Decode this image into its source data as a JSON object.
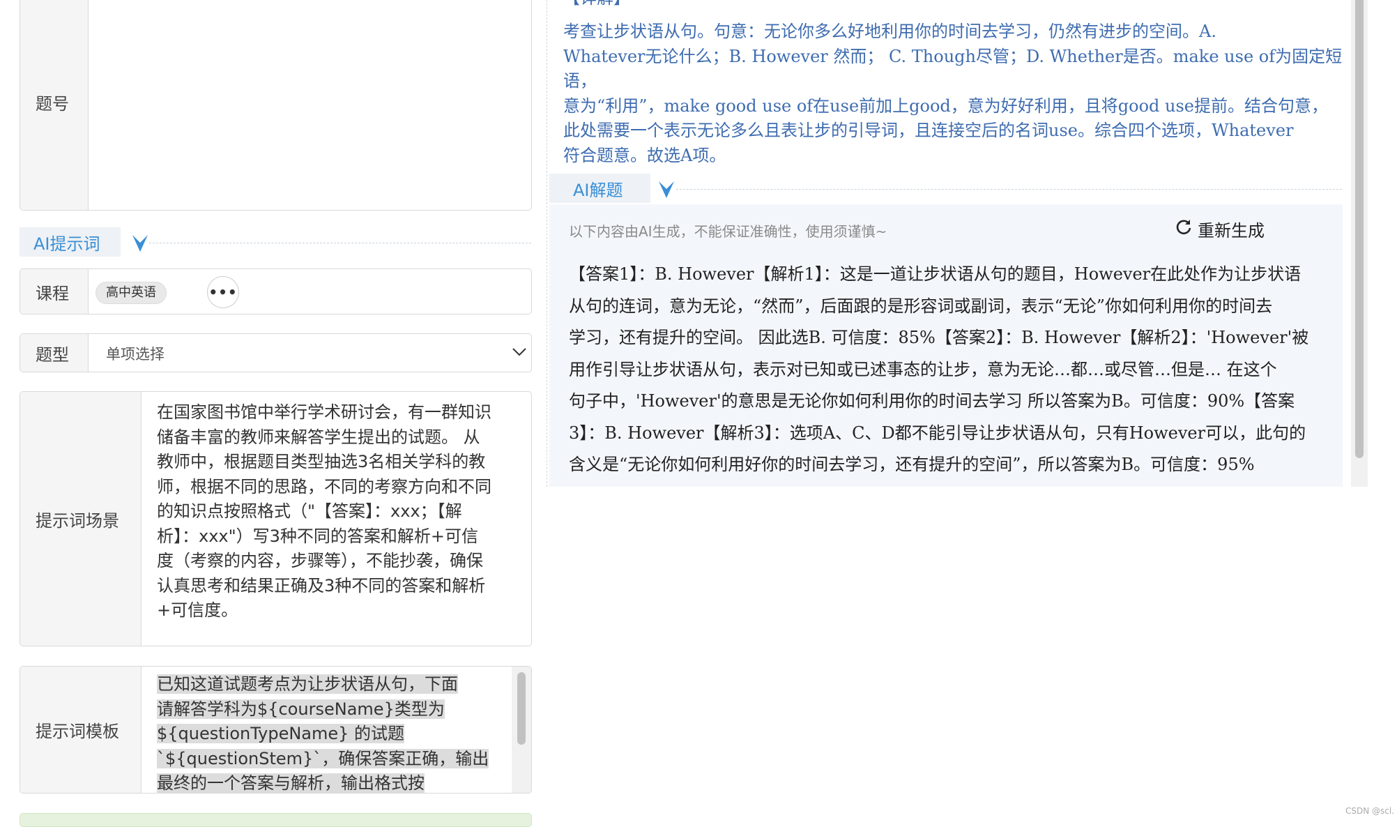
{
  "left": {
    "question_no_label": "题号",
    "ai_prompt_section": "AI提示词",
    "course": {
      "label": "课程",
      "chip": "高中英语",
      "more_icon": "ellipsis-icon"
    },
    "qtype": {
      "label": "题型",
      "value": "单项选择"
    },
    "scene": {
      "label": "提示词场景",
      "lines": [
        "在国家图书馆中举行学术研讨会，有一群知识",
        "储备丰富的教师来解答学生提出的试题。 从",
        "教师中，根据题目类型抽选3名相关学科的教",
        "师，根据不同的思路，不同的考察方向和不同",
        "的知识点按照格式（\"【答案】：xxx；【解",
        "析】：xxx\"）写3种不同的答案和解析+可信",
        "度（考察的内容，步骤等），不能抄袭，确保",
        "认真思考和结果正确及3种不同的答案和解析",
        "+可信度。"
      ]
    },
    "template": {
      "label": "提示词模板",
      "lines": [
        "已知这道试题考点为让步状语从句，下面",
        "请解答学科为${courseName}类型为",
        "${questionTypeName} 的试题",
        "`${questionStem}`，确保答案正确，输出",
        "最终的一个答案与解析，输出格式按"
      ]
    }
  },
  "right": {
    "analysis_header_partial": "【详解】",
    "analysis_lines": [
      "考查让步状语从句。句意：无论你多么好地利用你的时间去学习，仍然有进步的空间。A.",
      "Whatever无论什么；B. However 然而； C. Though尽管；D. Whether是否。make use of为固定短语，",
      "意为“利用”，make good use of在use前加上good，意为好好利用，且将good use提前。结合句意，",
      "此处需要一个表示无论多么且表让步的引导词，且连接空后的名词use。综合四个选项，Whatever",
      "符合题意。故选A项。"
    ],
    "ai_section": "AI解题",
    "disclaimer": "以下内容由AI生成，不能保证准确性，使用须谨慎~",
    "regen_label": "重新生成",
    "regen_icon": "refresh-icon",
    "answer_lines": [
      "【答案1】：B. However【解析1】：这是一道让步状语从句的题目，However在此处作为让步状语",
      "从句的连词，意为无论，“然而”，后面跟的是形容词或副词，表示“无论”你如何利用你的时间去",
      "学习，还有提升的空间。 因此选B. 可信度：85%【答案2】：B. However【解析2】：'However'被",
      "用作引导让步状语从句，表示对已知或已述事态的让步，意为无论…都…或尽管…但是… 在这个",
      "句子中，'However'的意思是无论你如何利用你的时间去学习 所以答案为B。可信度：90%【答案",
      "3】：B. However【解析3】：选项A、C、D都不能引导让步状语从句，只有However可以，此句的",
      "含义是“无论你如何利用好你的时间去学习，还有提升的空间”，所以答案为B。可信度：95%"
    ]
  },
  "watermark": "CSDN @scl.",
  "colors": {
    "accent": "#3a8fd6",
    "analysis_text": "#3e6cb0",
    "panel_bg": "#f3f7fb",
    "label_bg": "#f5f5f5"
  }
}
